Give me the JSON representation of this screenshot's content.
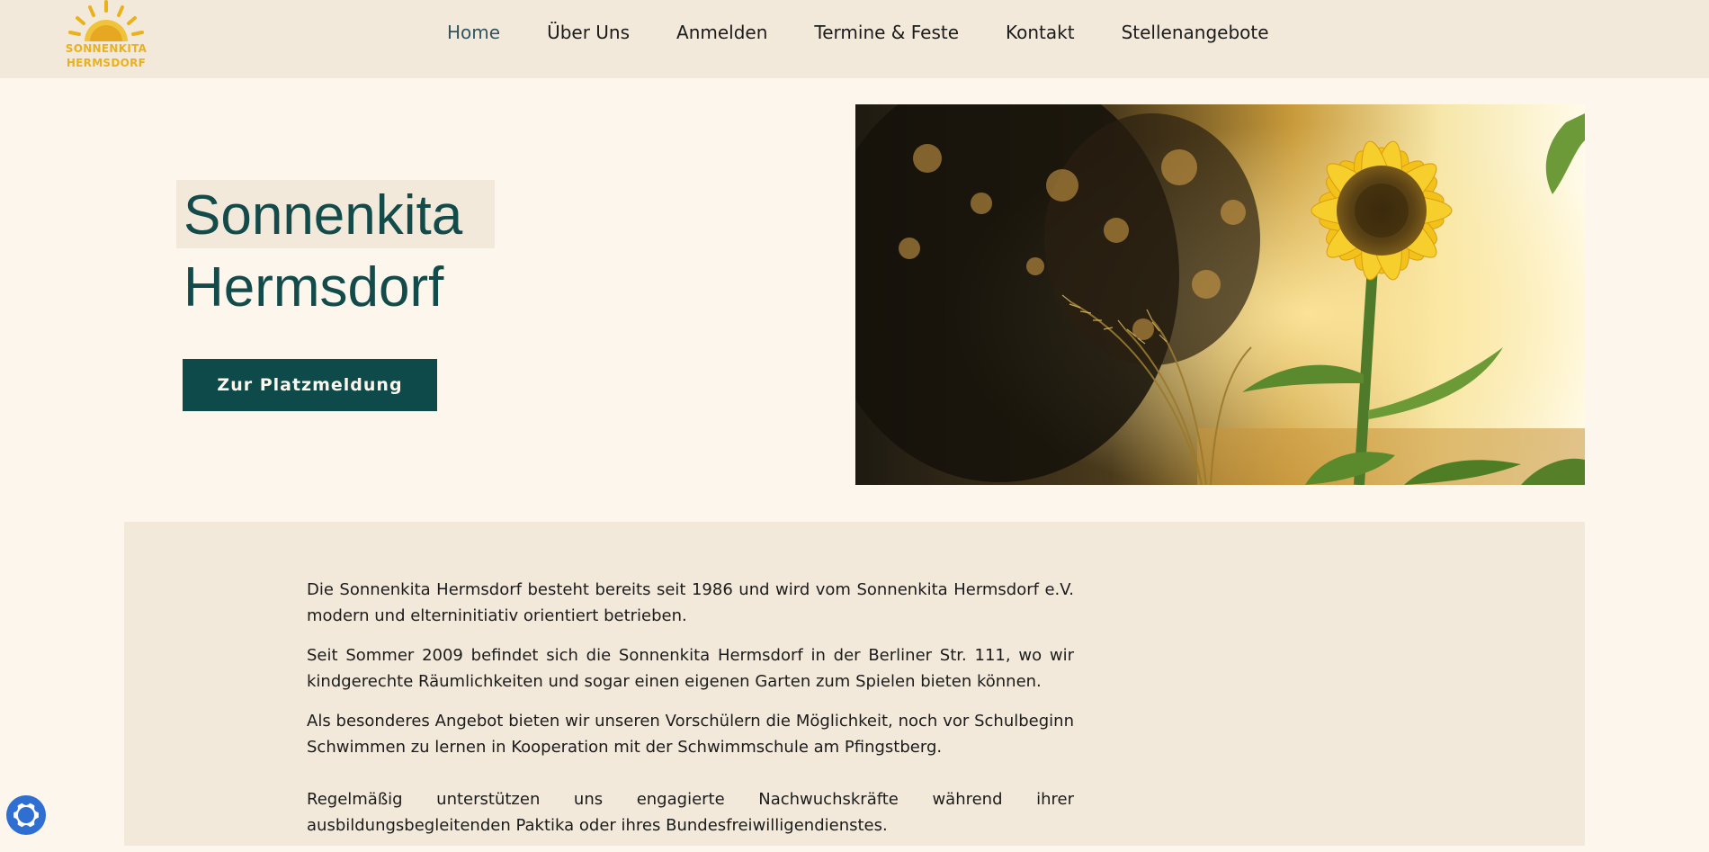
{
  "brand": {
    "logo_line1": "SONNENKITA",
    "logo_line2": "HERMSDORF",
    "logo_color": "#e9b21c"
  },
  "nav": {
    "items": [
      {
        "label": "Home",
        "active": true
      },
      {
        "label": "Über Uns"
      },
      {
        "label": "Anmelden"
      },
      {
        "label": "Termine & Feste"
      },
      {
        "label": "Kontakt"
      },
      {
        "label": "Stellenangebote"
      }
    ]
  },
  "hero": {
    "title_line1": "Sonnenkita",
    "title_line2": "Hermsdorf",
    "cta_label": "Zur Platzmeldung",
    "image_icon": "sunflower-photo"
  },
  "content": {
    "paragraphs": [
      "Die Sonnenkita Hermsdorf besteht bereits seit 1986 und wird vom Sonnenkita Hermsdorf e.V. modern und elterninitiativ orientiert betrieben.",
      "Seit Sommer 2009 befindet sich die Sonnenkita Hermsdorf in der Berliner Str. 111, wo wir kindgerechte Räumlichkeiten und sogar einen eigenen Garten zum Spielen bieten können.",
      "Als besonderes Angebot bieten wir unseren Vorschülern die Möglichkeit, noch vor Schulbeginn Schwimmen zu lernen in Kooperation mit der Schwimmschule am Pfingstberg.",
      "Regelmäßig unterstützen uns engagierte Nachwuchskräfte während ihrer ausbildungsbegleitenden Paktika oder ihres Bundesfreiwilligendienstes."
    ]
  },
  "colors": {
    "page_bg": "#fdf6ec",
    "header_bg": "#f3e9db",
    "accent": "#0f4a4a",
    "cookie_icon": "#2f6fd1"
  },
  "cookie": {
    "icon": "cookie-settings-icon"
  }
}
